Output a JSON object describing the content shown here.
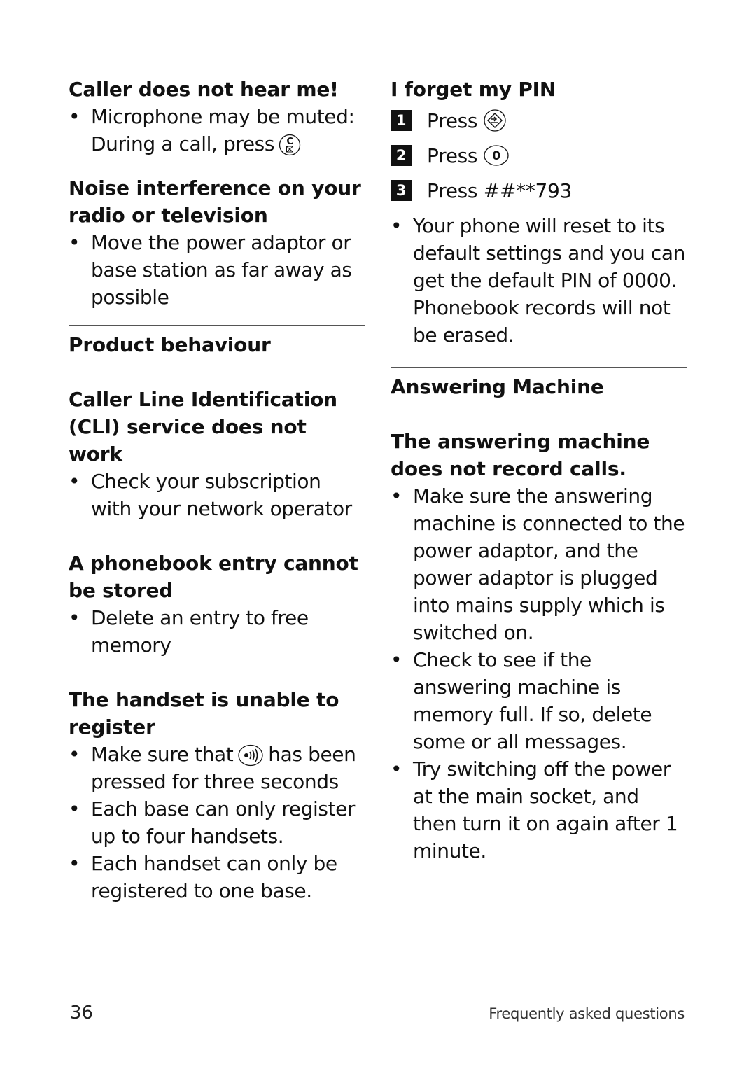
{
  "left_column": {
    "section1": {
      "heading": "Caller does not hear me!",
      "bullet1_pre": "Microphone may be muted: During a call, press",
      "bullet1_icon": "mute-c-key-icon"
    },
    "section2": {
      "heading": "Noise interference on your radio or television",
      "bullets": [
        "Move the power adaptor or base station as far away as possible"
      ]
    },
    "section3": {
      "heading": "Product behaviour"
    },
    "section4": {
      "heading": "Caller Line Identification (CLI) service does not work",
      "bullets": [
        "Check your subscription with your network operator"
      ]
    },
    "section5": {
      "heading": "A phonebook entry cannot be stored",
      "bullets": [
        "Delete an entry to free memory"
      ]
    },
    "section6": {
      "heading": "The handset is unable to register",
      "bullet1_pre": "Make sure that",
      "bullet1_icon": "paging-key-icon",
      "bullet1_post": "has been pressed for three seconds",
      "bullets": [
        "Each base can only register up to four handsets.",
        "Each handset can only be registered to one base."
      ]
    }
  },
  "right_column": {
    "section1": {
      "heading": "I forget my PIN",
      "steps": [
        {
          "num": "1",
          "label": "Press",
          "icon": "menu-ok-key-icon"
        },
        {
          "num": "2",
          "label": "Press",
          "icon": "zero-key-icon",
          "key_text": "0"
        },
        {
          "num": "3",
          "label": "Press ##**793"
        }
      ],
      "bullets": [
        "Your phone will reset to its default settings and you can get the default PIN of 0000. Phonebook records will not be erased."
      ]
    },
    "section2": {
      "heading": "Answering Machine"
    },
    "section3": {
      "heading": "The answering machine does not record calls.",
      "bullets": [
        "Make sure the answering machine is connected to the power adaptor, and the power adaptor is plugged into mains supply which is switched on.",
        "Check to see if the answering machine is memory full. If so, delete some or all messages.",
        "Try switching off the power at the main socket, and then turn it on again after 1 minute."
      ]
    }
  },
  "bullet_char": "•",
  "footer": {
    "page_number": "36",
    "section_title": "Frequently asked questions"
  }
}
